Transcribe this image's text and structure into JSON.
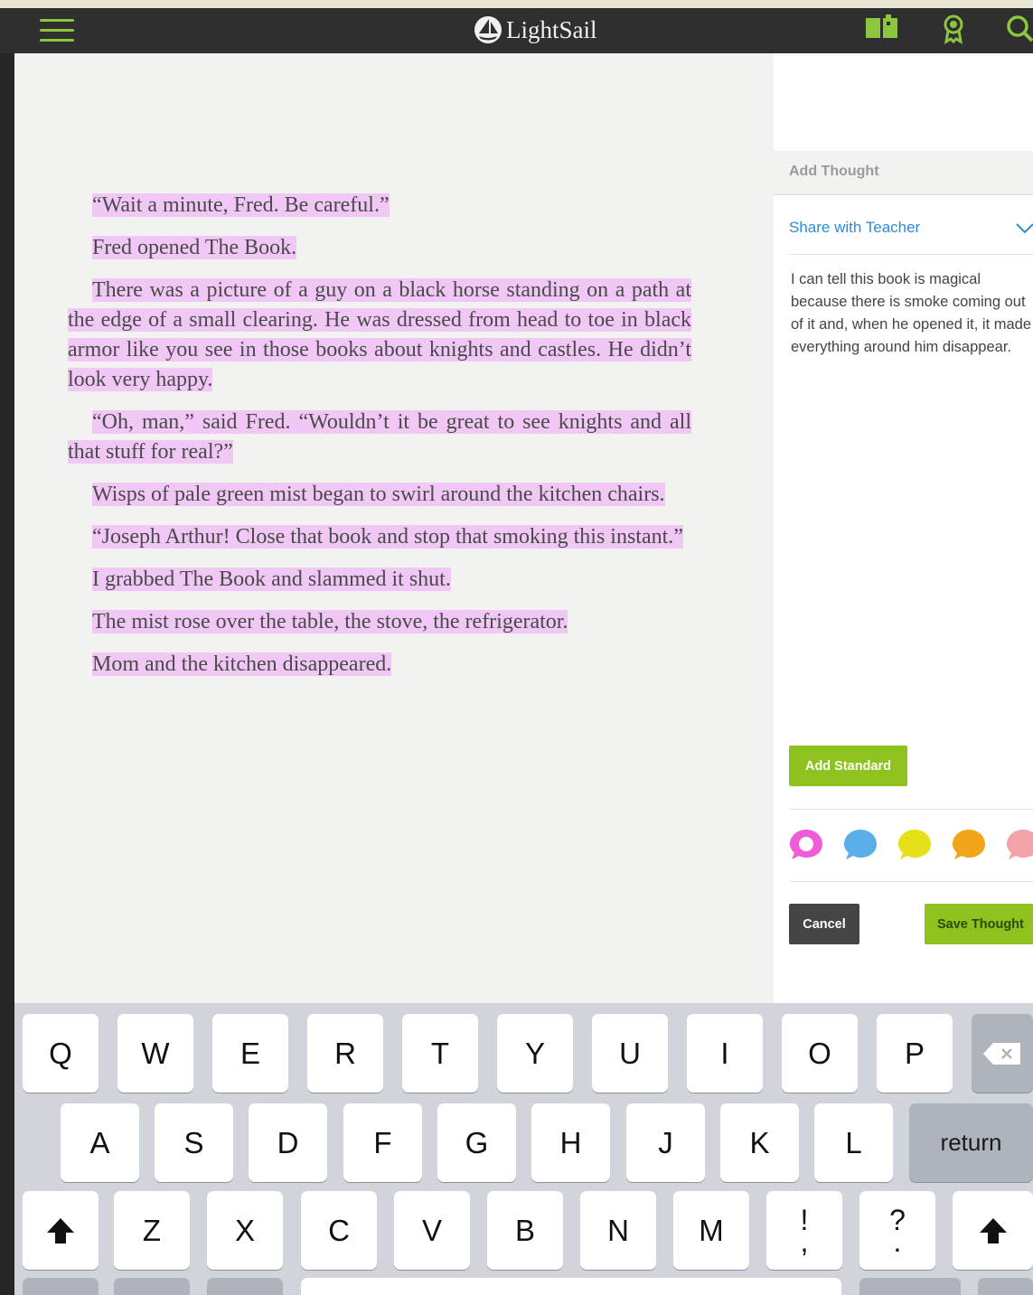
{
  "app": {
    "brand": "LightSail"
  },
  "icons": {
    "menu": "menu-icon",
    "book": "library-book-icon",
    "award": "award-badge-icon",
    "search": "search-icon"
  },
  "reader": {
    "paragraphs": [
      "“Wait a minute, Fred. Be careful.”",
      "Fred opened The Book.",
      "There was a picture of a guy on a black horse standing on a path at the edge of a small clearing. He was dressed from head to toe in black armor like you see in those books about knights and castles. He didn’t look very happy.",
      "“Oh, man,” said Fred. “Wouldn’t it be great to see knights and all that stuff for real?”",
      "Wisps of pale green mist began to swirl around the kitchen chairs.",
      "“Joseph Arthur! Close that book and stop that smoking this instant.”",
      "I grabbed The Book and slammed it shut.",
      "The mist rose over the table, the stove, the refrigerator.",
      "Mom and the kitchen disappeared."
    ],
    "highlight_color": "#f1c8f5"
  },
  "thought_panel": {
    "title": "Add Thought",
    "share_label": "Share with Teacher",
    "thought_text": "I can tell this book is magical because there is smoke coming out of it and, when he opened it, it made everything around him disappear.",
    "add_standard_label": "Add Standard",
    "cancel_label": "Cancel",
    "save_label": "Save Thought",
    "colors": [
      "#f05bd8",
      "#5aaee8",
      "#e6e01a",
      "#f2a51a",
      "#f4a3a8"
    ]
  },
  "keyboard": {
    "row1": [
      "Q",
      "W",
      "E",
      "R",
      "T",
      "Y",
      "U",
      "I",
      "O",
      "P"
    ],
    "row2": [
      "A",
      "S",
      "D",
      "F",
      "G",
      "H",
      "J",
      "K",
      "L"
    ],
    "row3": [
      "Z",
      "X",
      "C",
      "V",
      "B",
      "N",
      "M"
    ],
    "return_label": "return",
    "punct1_top": "!",
    "punct1_bottom": ",",
    "punct2_top": "?",
    "punct2_bottom": "."
  }
}
